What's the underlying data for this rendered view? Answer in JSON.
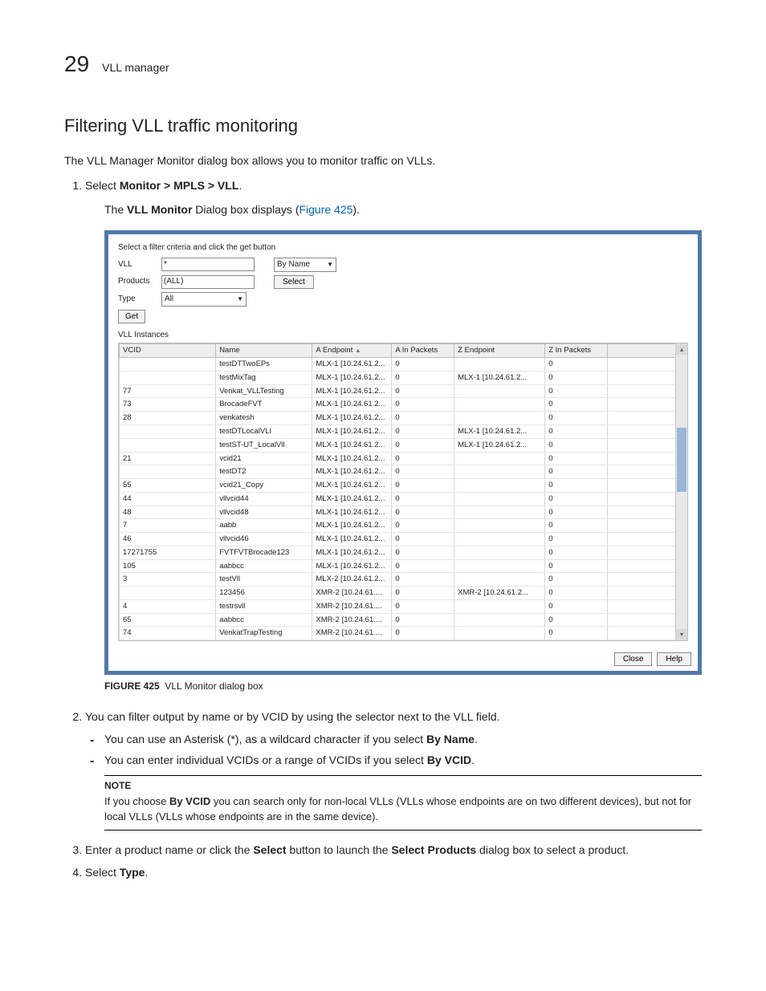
{
  "header": {
    "pagenum": "29",
    "title": "VLL manager"
  },
  "section": {
    "heading": "Filtering VLL traffic monitoring",
    "intro": "The VLL Manager Monitor dialog box allows you to monitor traffic on VLLs.",
    "step1": {
      "num": "1.",
      "lead": "Select ",
      "bold": "Monitor > MPLS > VLL",
      "tail": ".",
      "sub_a": "The ",
      "sub_b": "VLL Monitor",
      "sub_c": " Dialog box displays (",
      "sub_link": "Figure 425",
      "sub_d": ")."
    },
    "step2": {
      "num": "2.",
      "text": "You can filter output by name or by VCID by using the selector next to the VLL field.",
      "b1_a": "You can use an Asterisk (*), as a wildcard character if you select ",
      "b1_b": "By Name",
      "b1_c": ".",
      "b2_a": "You can enter individual VCIDs or a range of VCIDs if you select ",
      "b2_b": "By VCID",
      "b2_c": "."
    },
    "note": {
      "title": "NOTE",
      "a": "If you choose ",
      "b": "By VCID",
      "c": " you can search only for non-local VLLs (VLLs whose endpoints are on two different devices), but not for local VLLs (VLLs whose endpoints are in the same device)."
    },
    "step3": {
      "num": "3.",
      "a": "Enter a product name or click the ",
      "b": "Select",
      "c": " button to launch the ",
      "d": "Select Products",
      "e": " dialog box to select a product."
    },
    "step4": {
      "num": "4.",
      "a": "Select ",
      "b": "Type",
      "c": "."
    }
  },
  "figure": {
    "label": "FIGURE 425",
    "caption": "VLL Monitor dialog box"
  },
  "dialog": {
    "topline": "Select a filter criteria and click the get button",
    "labels": {
      "vll": "VLL",
      "products": "Products",
      "type": "Type"
    },
    "vll_value": "*",
    "byname": "By Name",
    "byname_tri": "▼",
    "products_value": "(ALL)",
    "select_btn": "Select",
    "type_value": "All",
    "type_tri": "▼",
    "get_btn": "Get",
    "table_title": "VLL Instances",
    "cols": {
      "vcid": "VCID",
      "name": "Name",
      "aep": "A Endpoint",
      "ain": "A In Packets",
      "zep": "Z Endpoint",
      "zin": "Z In Packets"
    },
    "sort": "▲",
    "rows": [
      {
        "vcid": "",
        "name": "testDTTwoEPs",
        "aep": "MLX-1 [10.24.61.2...",
        "ain": "0",
        "zep": "",
        "zin": "0"
      },
      {
        "vcid": "",
        "name": "testMixTag",
        "aep": "MLX-1 [10.24.61.2...",
        "ain": "0",
        "zep": "MLX-1 [10.24.61.2...",
        "zin": "0"
      },
      {
        "vcid": "77",
        "name": "Venkat_VLLTesting",
        "aep": "MLX-1 [10.24.61.2...",
        "ain": "0",
        "zep": "",
        "zin": "0"
      },
      {
        "vcid": "73",
        "name": "BrocadeFVT",
        "aep": "MLX-1 [10.24.61.2...",
        "ain": "0",
        "zep": "",
        "zin": "0"
      },
      {
        "vcid": "28",
        "name": "venkatesh",
        "aep": "MLX-1 [10.24.61.2...",
        "ain": "0",
        "zep": "",
        "zin": "0"
      },
      {
        "vcid": "",
        "name": "testDTLocalVLI",
        "aep": "MLX-1 [10.24.61.2...",
        "ain": "0",
        "zep": "MLX-1 [10.24.61.2...",
        "zin": "0"
      },
      {
        "vcid": "",
        "name": "testST-UT_LocalVll",
        "aep": "MLX-1 [10.24.61.2...",
        "ain": "0",
        "zep": "MLX-1 [10.24.61.2...",
        "zin": "0"
      },
      {
        "vcid": "21",
        "name": "vcid21",
        "aep": "MLX-1 [10.24.61.2...",
        "ain": "0",
        "zep": "",
        "zin": "0"
      },
      {
        "vcid": "",
        "name": "testDT2",
        "aep": "MLX-1 [10.24.61.2...",
        "ain": "0",
        "zep": "",
        "zin": "0"
      },
      {
        "vcid": "55",
        "name": "vcid21_Copy",
        "aep": "MLX-1 [10.24.61.2...",
        "ain": "0",
        "zep": "",
        "zin": "0"
      },
      {
        "vcid": "44",
        "name": "vllvcid44",
        "aep": "MLX-1 [10.24.61.2...",
        "ain": "0",
        "zep": "",
        "zin": "0"
      },
      {
        "vcid": "48",
        "name": "vllvcid48",
        "aep": "MLX-1 [10.24.61.2...",
        "ain": "0",
        "zep": "",
        "zin": "0"
      },
      {
        "vcid": "7",
        "name": "aabb",
        "aep": "MLX-1 [10.24.61.2...",
        "ain": "0",
        "zep": "",
        "zin": "0"
      },
      {
        "vcid": "46",
        "name": "vllvcid46",
        "aep": "MLX-1 [10.24.61.2...",
        "ain": "0",
        "zep": "",
        "zin": "0"
      },
      {
        "vcid": "17271755",
        "name": "FVTFVTBrocade123",
        "aep": "MLX-1 [10.24.61.2...",
        "ain": "0",
        "zep": "",
        "zin": "0"
      },
      {
        "vcid": "105",
        "name": "aabbcc",
        "aep": "MLX-1 [10.24.61.2...",
        "ain": "0",
        "zep": "",
        "zin": "0"
      },
      {
        "vcid": "3",
        "name": "testVll",
        "aep": "MLX-2 [10.24.61.2...",
        "ain": "0",
        "zep": "",
        "zin": "0"
      },
      {
        "vcid": "",
        "name": "123456",
        "aep": "XMR-2 [10.24.61....",
        "ain": "0",
        "zep": "XMR-2 [10.24.61.2...",
        "zin": "0"
      },
      {
        "vcid": "4",
        "name": "testrsvll",
        "aep": "XMR-2 [10.24.61....",
        "ain": "0",
        "zep": "",
        "zin": "0"
      },
      {
        "vcid": "65",
        "name": "aabbcc",
        "aep": "XMR-2 [10.24.61....",
        "ain": "0",
        "zep": "",
        "zin": "0"
      },
      {
        "vcid": "74",
        "name": "VenkatTrapTesting",
        "aep": "XMR-2 [10.24.61....",
        "ain": "0",
        "zep": "",
        "zin": "0"
      }
    ],
    "close_btn": "Close",
    "help_btn": "Help",
    "scroll_up": "▴",
    "scroll_dn": "▾"
  }
}
